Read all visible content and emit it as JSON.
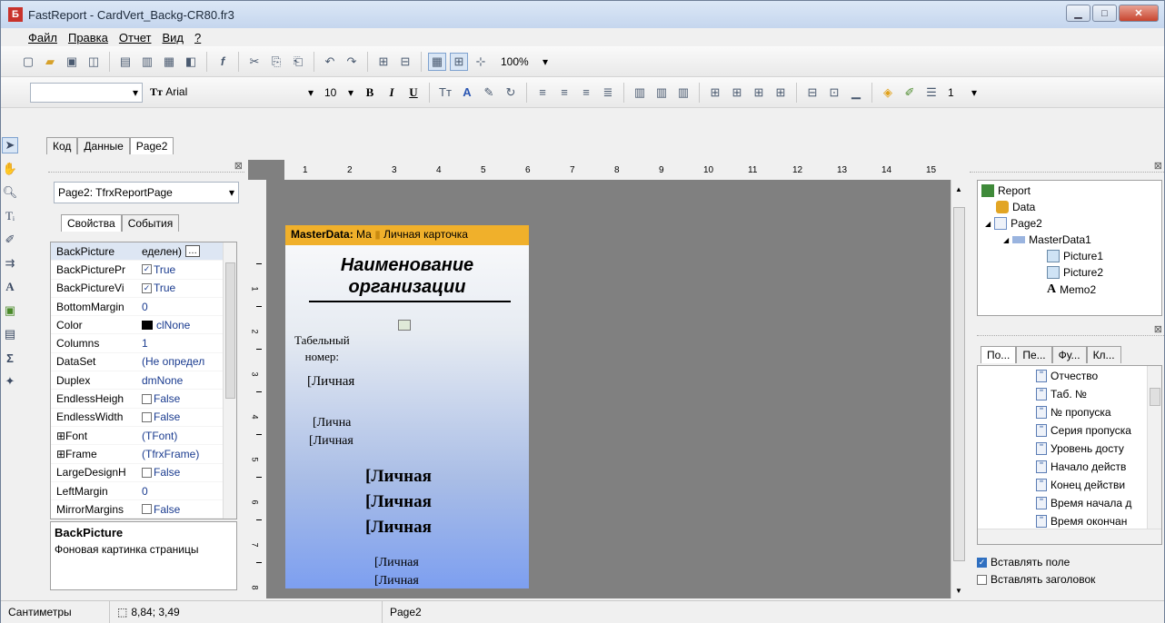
{
  "window": {
    "title": "FastReport - CardVert_Backg-CR80.fr3",
    "app_icon": "Б"
  },
  "menu": [
    "Файл",
    "Правка",
    "Отчет",
    "Вид",
    "?"
  ],
  "toolbar1": {
    "zoom": "100%"
  },
  "toolbar2": {
    "style_combo": "",
    "font_name": "Arial",
    "font_size": "10",
    "bold": "B",
    "italic": "I",
    "underline": "U",
    "frame_width": "1"
  },
  "design_tabs": [
    "Код",
    "Данные",
    "Page2"
  ],
  "object_inspector": {
    "selected": "Page2: TfrxReportPage",
    "tabs": [
      "Свойства",
      "События"
    ],
    "properties": [
      {
        "name": "BackPicture",
        "value": "еделен)",
        "kind": "ellipsis"
      },
      {
        "name": "BackPicturePr",
        "value": "True",
        "kind": "check"
      },
      {
        "name": "BackPictureVi",
        "value": "True",
        "kind": "check"
      },
      {
        "name": "BottomMargin",
        "value": "0",
        "kind": "text"
      },
      {
        "name": "Color",
        "value": "clNone",
        "kind": "color"
      },
      {
        "name": "Columns",
        "value": "1",
        "kind": "text"
      },
      {
        "name": "DataSet",
        "value": "(Не определ",
        "kind": "text"
      },
      {
        "name": "Duplex",
        "value": "dmNone",
        "kind": "text"
      },
      {
        "name": "EndlessHeigh",
        "value": "False",
        "kind": "uncheck"
      },
      {
        "name": "EndlessWidth",
        "value": "False",
        "kind": "uncheck"
      },
      {
        "name": "⊞Font",
        "value": "(TFont)",
        "kind": "text"
      },
      {
        "name": "⊞Frame",
        "value": "(TfrxFrame)",
        "kind": "text"
      },
      {
        "name": "LargeDesignH",
        "value": "False",
        "kind": "uncheck"
      },
      {
        "name": "LeftMargin",
        "value": "0",
        "kind": "text"
      },
      {
        "name": "MirrorMargins",
        "value": "False",
        "kind": "uncheck"
      }
    ],
    "help_title": "BackPicture",
    "help_text": "Фоновая картинка страницы"
  },
  "ruler": {
    "h": [
      "1",
      "2",
      "3",
      "4",
      "5",
      "6",
      "7",
      "8",
      "9",
      "10",
      "11",
      "12",
      "13",
      "14",
      "15"
    ],
    "v": [
      "1",
      "2",
      "3",
      "4",
      "5",
      "6",
      "7",
      "8"
    ]
  },
  "page": {
    "band_label": "MasterData:",
    "band_name": "Ма",
    "band_caption": "Личная карточка",
    "org_line1": "Наименование",
    "org_line2": "организации",
    "tab_label1": "Табельный",
    "tab_label2": "номер:",
    "memo1": "[Личная",
    "memo2": "[Лична",
    "memo3": "[Личная",
    "memo4": "[Личная",
    "memo5": "[Личная",
    "memo6": "[Личная",
    "memo7": "[Личная",
    "memo8": "[Личная"
  },
  "report_tree": {
    "items": [
      "Report",
      "Data",
      "Page2",
      "MasterData1",
      "Picture1",
      "Picture2",
      "Memo2"
    ]
  },
  "data_tabs": [
    "По...",
    "Пе...",
    "Фу...",
    "Кл..."
  ],
  "data_fields": [
    "Отчество",
    "Таб. №",
    "№ пропуска",
    "Серия пропуска",
    "Уровень досту",
    "Начало действ",
    "Конец действи",
    "Время начала д",
    "Время окончан"
  ],
  "options": {
    "insert_field": "Вставлять поле",
    "insert_header": "Вставлять заголовок"
  },
  "status": {
    "units": "Сантиметры",
    "coords": "8,84; 3,49",
    "page": "Page2"
  }
}
